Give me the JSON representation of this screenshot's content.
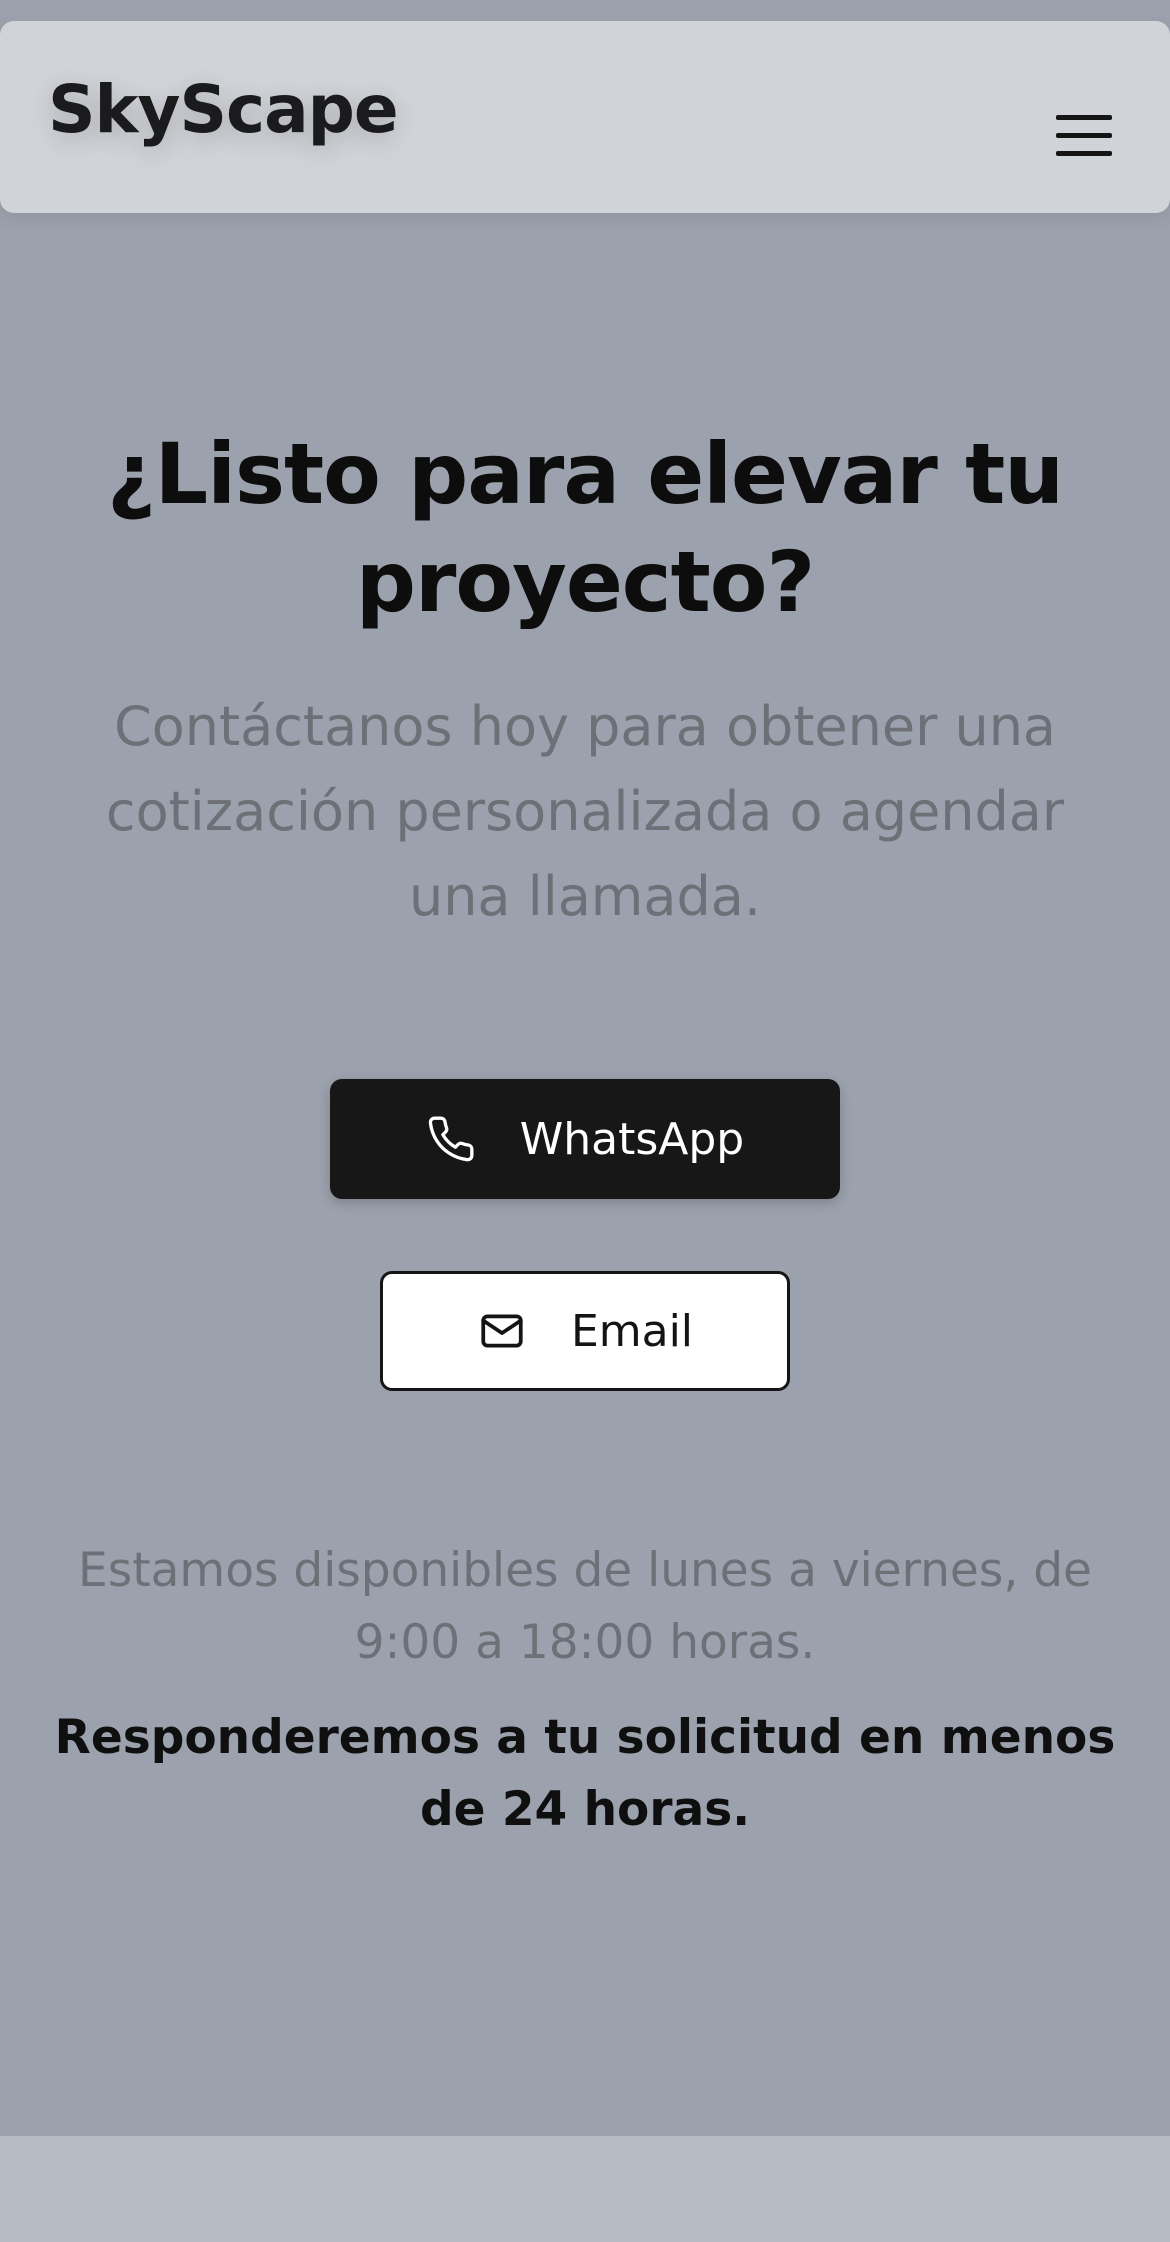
{
  "header": {
    "brand": "SkyScape",
    "menu_icon": "hamburger-menu-icon"
  },
  "hero": {
    "title": "¿Listo para elevar tu proyecto?",
    "subtitle": "Contáctanos hoy para obtener una cotización personalizada o agendar una llamada."
  },
  "contact": {
    "whatsapp_label": "WhatsApp",
    "whatsapp_icon": "phone-icon",
    "email_label": "Email",
    "email_icon": "mail-icon"
  },
  "info": {
    "availability": "Estamos disponibles de lunes a viernes, de 9:00 a 18:00 horas.",
    "response": "Responderemos a tu solicitud en menos de 24 horas."
  },
  "colors": {
    "background": "#9ca2ad",
    "header": "#d0d3d8",
    "primary_button": "#171717",
    "footer": "#b6bac2"
  }
}
